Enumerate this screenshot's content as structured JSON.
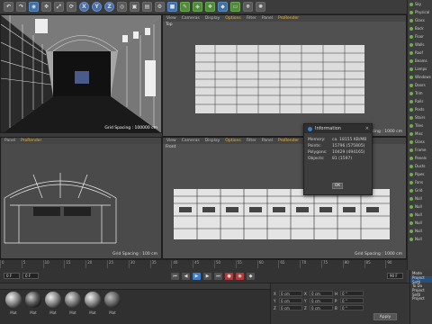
{
  "toolbar": {
    "icons": [
      "undo-icon",
      "redo-icon",
      "live-select-icon",
      "move-icon",
      "scale-icon",
      "rotate-icon",
      "x-axis-icon",
      "y-axis-icon",
      "z-axis-icon",
      "world-coords-icon",
      "render-view-icon",
      "render-picture-viewer-icon",
      "render-settings-icon",
      "cube-icon",
      "pen-icon",
      "subdivision-icon",
      "array-icon",
      "deformer-icon",
      "floor-icon",
      "camera-icon",
      "light-icon"
    ],
    "axis_x": "X",
    "axis_y": "Y",
    "axis_z": "Z"
  },
  "viewports": {
    "perspective": {
      "grid": "Grid Spacing : 100000 cm"
    },
    "top": {
      "menu": [
        "View",
        "Cameras",
        "Display",
        "Options",
        "Filter",
        "Panel",
        "ProRender"
      ],
      "label": "Top",
      "grid": "Grid Spacing : 1000 cm"
    },
    "right": {
      "menu": [
        "Panel",
        "ProRender"
      ],
      "grid": "Grid Spacing : 100 cm"
    },
    "front": {
      "menu": [
        "View",
        "Cameras",
        "Display",
        "Options",
        "Filter",
        "Panel",
        "ProRender"
      ],
      "label": "Front",
      "grid": "Grid Spacing : 1000 cm"
    },
    "active_menu_items": [
      "Options",
      "ProRender"
    ]
  },
  "info_dialog": {
    "title": "Information",
    "close": "×",
    "rows": [
      {
        "key": "Memory:",
        "value": "ca. 18155 KB/MB"
      },
      {
        "key": "Points:",
        "value": "15796 (575805)"
      },
      {
        "key": "Polygons:",
        "value": "10429 (494165)"
      },
      {
        "key": "Objects:",
        "value": "81 (1597)"
      }
    ],
    "ok_label": "OK"
  },
  "timeline": {
    "ticks": [
      "0",
      "5",
      "10",
      "15",
      "20",
      "25",
      "30",
      "35",
      "40",
      "45",
      "50",
      "55",
      "60",
      "65",
      "70",
      "75",
      "80",
      "85",
      "90"
    ],
    "start_field": "0 F",
    "end_field": "90 F",
    "current_field": "0 F"
  },
  "materials": {
    "labels": [
      "Mat",
      "Mat",
      "Mat",
      "Mat",
      "Mat",
      "Mat"
    ]
  },
  "coordinates": {
    "rows": [
      {
        "axis1": "X",
        "v1": "0 cm",
        "axis2": "X",
        "v2": "0 cm",
        "axis3": "H",
        "v3": "0 °"
      },
      {
        "axis1": "Y",
        "v1": "0 cm",
        "axis2": "Y",
        "v2": "0 cm",
        "axis3": "P",
        "v3": "0 °"
      },
      {
        "axis1": "Z",
        "v1": "0 cm",
        "axis2": "Z",
        "v2": "0 cm",
        "axis3": "B",
        "v3": "0 °"
      }
    ],
    "apply_label": "Apply"
  },
  "right_panel": {
    "rows": [
      "Sky",
      "Physical",
      "Glass",
      "Back",
      "Floor",
      "Walls",
      "Roof",
      "Beams",
      "Lamps",
      "Windows",
      "Doors",
      "Trim",
      "Rails",
      "Posts",
      "Stairs",
      "Tiles",
      "Misc",
      "Glass",
      "Frame",
      "Panels",
      "Ducts",
      "Pipes",
      "Fans",
      "Grid",
      "Null",
      "Null",
      "Null",
      "Null",
      "Null",
      "Null"
    ]
  },
  "attributes": {
    "tabs": [
      "Mode",
      "Project Setti",
      "To Do",
      "Project Setti",
      "Project"
    ],
    "active_tab_index": 1
  },
  "colors": {
    "accent_orange": "#e8b84a",
    "active_blue": "#3d7cc9",
    "object_green": "#6fae4a",
    "record_red": "#b23a3a"
  }
}
